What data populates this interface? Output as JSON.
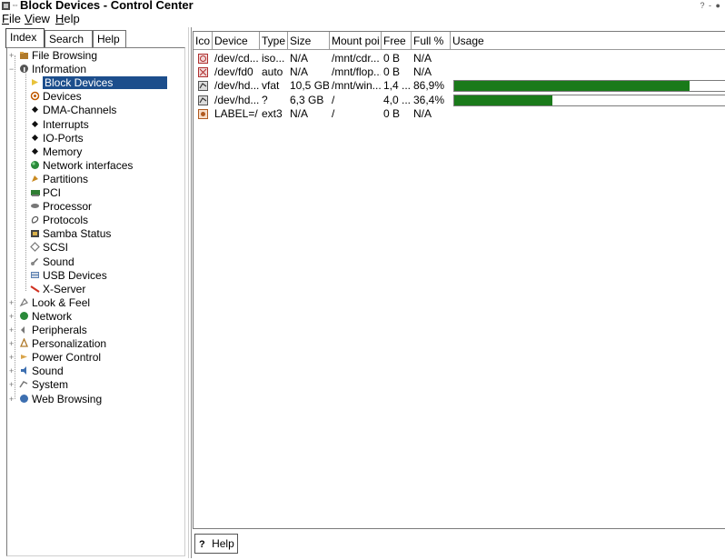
{
  "window": {
    "title": "Block Devices - Control Center",
    "controls": "? - ●"
  },
  "menubar": {
    "items": [
      {
        "label": "File",
        "accel": "F"
      },
      {
        "label": "View",
        "accel": "V"
      },
      {
        "label": "Help",
        "accel": "H"
      }
    ]
  },
  "left_tabs": [
    {
      "label": "Index",
      "active": true
    },
    {
      "label": "Search"
    },
    {
      "label": "Help"
    }
  ],
  "tree": [
    {
      "label": "File Browsing",
      "icon": "folder-icon",
      "level": 0,
      "expandable": true
    },
    {
      "label": "Information",
      "icon": "info-icon",
      "level": 0,
      "expanded": true
    },
    {
      "label": "Block Devices",
      "icon": "block-devices-icon",
      "level": 1,
      "selected": true
    },
    {
      "label": "Devices",
      "icon": "devices-icon",
      "level": 1
    },
    {
      "label": "DMA-Channels",
      "icon": "bullet-icon",
      "level": 1
    },
    {
      "label": "Interrupts",
      "icon": "bullet-icon",
      "level": 1
    },
    {
      "label": "IO-Ports",
      "icon": "bullet-icon",
      "level": 1
    },
    {
      "label": "Memory",
      "icon": "bullet-icon",
      "level": 1
    },
    {
      "label": "Network interfaces",
      "icon": "network-globe-icon",
      "level": 1
    },
    {
      "label": "Partitions",
      "icon": "partitions-icon",
      "level": 1
    },
    {
      "label": "PCI",
      "icon": "pci-card-icon",
      "level": 1
    },
    {
      "label": "Processor",
      "icon": "processor-icon",
      "level": 1
    },
    {
      "label": "Protocols",
      "icon": "protocols-icon",
      "level": 1
    },
    {
      "label": "Samba Status",
      "icon": "samba-icon",
      "level": 1
    },
    {
      "label": "SCSI",
      "icon": "scsi-icon",
      "level": 1
    },
    {
      "label": "Sound",
      "icon": "sound-icon",
      "level": 1
    },
    {
      "label": "USB Devices",
      "icon": "usb-icon",
      "level": 1
    },
    {
      "label": "X-Server",
      "icon": "x-server-icon",
      "level": 1
    },
    {
      "label": "Look & Feel",
      "icon": "look-feel-icon",
      "level": 0,
      "expandable": true
    },
    {
      "label": "Network",
      "icon": "network-icon",
      "level": 0,
      "expandable": true
    },
    {
      "label": "Peripherals",
      "icon": "peripherals-icon",
      "level": 0,
      "expandable": true
    },
    {
      "label": "Personalization",
      "icon": "personalization-icon",
      "level": 0,
      "expandable": true
    },
    {
      "label": "Power Control",
      "icon": "power-icon",
      "level": 0,
      "expandable": true
    },
    {
      "label": "Sound",
      "icon": "speaker-icon",
      "level": 0,
      "expandable": true
    },
    {
      "label": "System",
      "icon": "system-icon",
      "level": 0,
      "expandable": true
    },
    {
      "label": "Web Browsing",
      "icon": "web-icon",
      "level": 0,
      "expandable": true
    }
  ],
  "table": {
    "columns": [
      "Ico",
      "Device",
      "Type",
      "Size",
      "Mount poi",
      "Free",
      "Full %",
      "Usage"
    ],
    "rows": [
      {
        "icon": "cdrom-icon",
        "device": "/dev/cd...",
        "type": "iso...",
        "size": "N/A",
        "mount": "/mnt/cdr...",
        "free": "0 B",
        "full": "N/A",
        "usage": null
      },
      {
        "icon": "floppy-icon",
        "device": "/dev/fd0",
        "type": "auto",
        "size": "N/A",
        "mount": "/mnt/flop...",
        "free": "0 B",
        "full": "N/A",
        "usage": null
      },
      {
        "icon": "harddisk-icon",
        "device": "/dev/hd...",
        "type": "vfat",
        "size": "10,5 GB",
        "mount": "/mnt/win...",
        "free": "1,4 ...",
        "full": "86,9%",
        "usage": 0.869
      },
      {
        "icon": "harddisk-icon",
        "device": "/dev/hd...",
        "type": "?",
        "size": "6,3 GB",
        "mount": "/",
        "free": "4,0 ...",
        "full": "36,4%",
        "usage": 0.364
      },
      {
        "icon": "label-disk-icon",
        "device": "LABEL=/",
        "type": "ext3",
        "size": "N/A",
        "mount": "/",
        "free": "0 B",
        "full": "N/A",
        "usage": null
      }
    ]
  },
  "help_button": {
    "label": "Help",
    "icon": "question-icon"
  },
  "colors": {
    "selection": "#1c4e8c",
    "usage_fill": "#1a7a1a"
  }
}
